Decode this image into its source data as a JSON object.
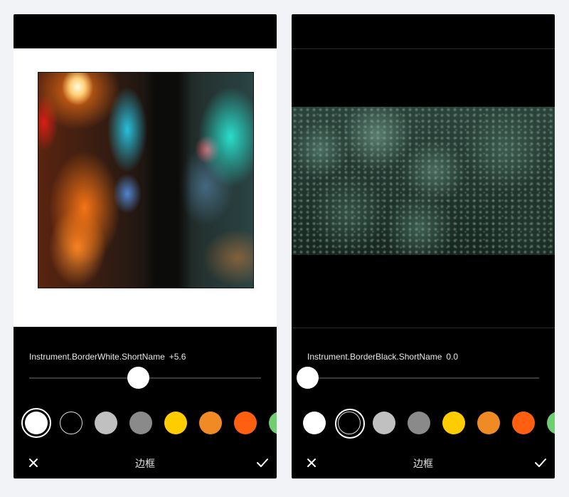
{
  "left_panel": {
    "label": "Instrument.BorderWhite.ShortName",
    "value": "+5.6",
    "slider_level": 0.47,
    "title": "边框",
    "selected_swatch": 0
  },
  "right_panel": {
    "label": "Instrument.BorderBlack.ShortName",
    "value": "0.0",
    "slider_level": 0.0,
    "title": "边框",
    "selected_swatch": 1
  },
  "swatch_colors": [
    "#ffffff",
    "#000000",
    "#c0c0c0",
    "#8a8a8a",
    "#ffcc00",
    "#f08a24",
    "#ff5f0f",
    "#6fcf70"
  ],
  "icons": {
    "cancel": "close-icon",
    "confirm": "checkmark-icon"
  }
}
